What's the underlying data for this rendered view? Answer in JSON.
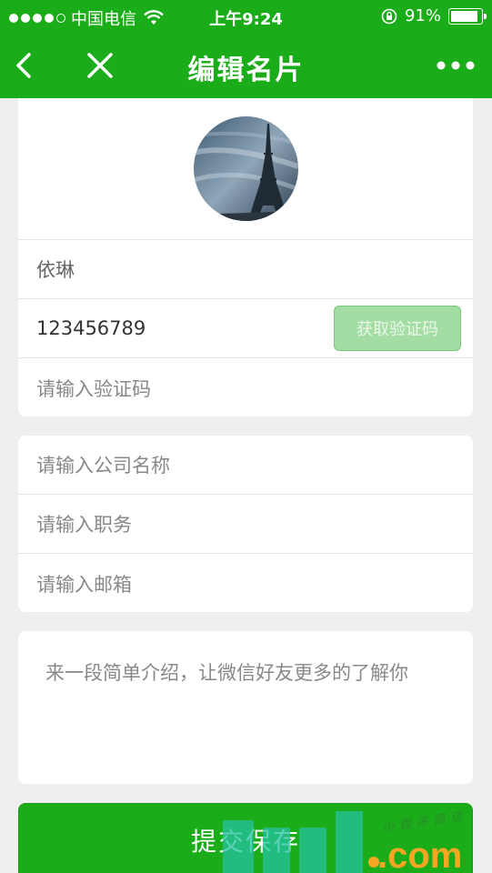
{
  "status_bar": {
    "carrier": "中国电信",
    "time": "上午9:24",
    "battery": "91%",
    "battery_level": 0.91
  },
  "nav": {
    "title": "编辑名片",
    "back_icon": "chevron-left-icon",
    "close_icon": "close-icon",
    "more_icon": "more-dots-icon"
  },
  "form": {
    "name_value": "依琳",
    "phone_value": "123456789",
    "get_code_label": "获取验证码",
    "code_placeholder": "请输入验证码",
    "company_placeholder": "请输入公司名称",
    "position_placeholder": "请输入职务",
    "email_placeholder": "请输入邮箱",
    "intro_placeholder": "来一段简单介绍，让微信好友更多的了解你"
  },
  "submit_label": "提交保存",
  "watermark": {
    "text": ".com",
    "small_text": "小程序商店"
  },
  "colors": {
    "brand_green": "#1aad19",
    "disabled_green": "#a3dda3"
  }
}
